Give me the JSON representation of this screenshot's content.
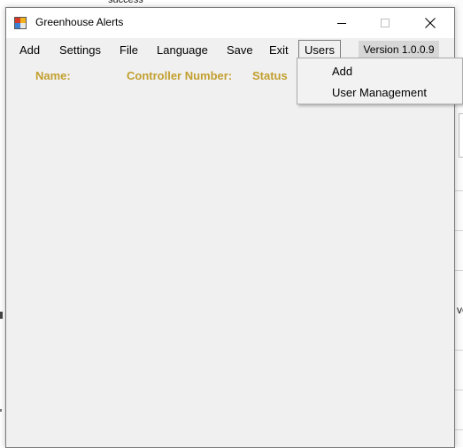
{
  "background": {
    "top_text": "success",
    "right_text": "ve"
  },
  "window": {
    "title": "Greenhouse Alerts",
    "icon": "app-window-icon"
  },
  "menu": {
    "items": [
      "Add",
      "Settings",
      "File",
      "Language",
      "Save",
      "Exit",
      "Users"
    ],
    "version": "Version 1.0.0.9"
  },
  "columns": {
    "name": "Name:",
    "controller": "Controller Number:",
    "status": "Status"
  },
  "users_dropdown": {
    "items": [
      "Add",
      "User Management"
    ]
  },
  "colors": {
    "header_text": "#c29f2e",
    "window_bg": "#f0f0f0",
    "version_bg": "#d7d7d7"
  }
}
